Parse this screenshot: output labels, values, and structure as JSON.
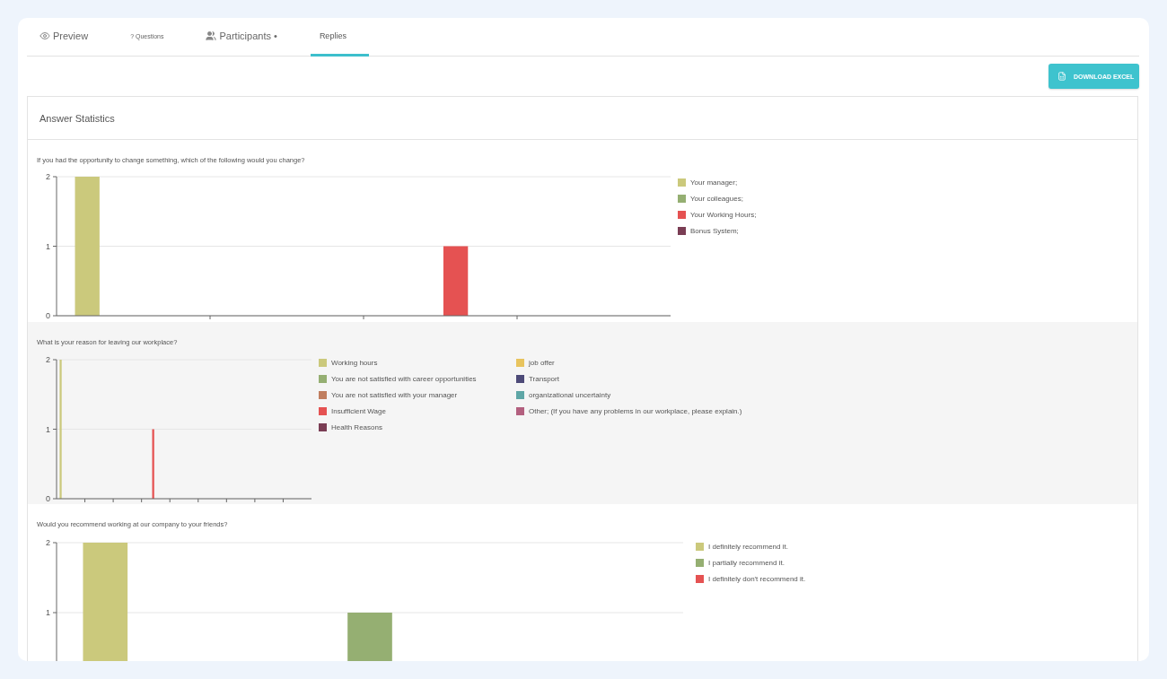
{
  "tabs": [
    {
      "label": "Preview",
      "selected": false
    },
    {
      "label": "? Questions",
      "selected": false
    },
    {
      "label": "Participants •",
      "selected": false
    },
    {
      "label": "Replies",
      "selected": true
    }
  ],
  "download_button": {
    "label": "DOWNLOAD EXCEL"
  },
  "panel": {
    "title": "Answer Statistics",
    "questions": [
      {
        "text": "If you had the opportunity to change something, which of the following would you change?",
        "chart_data": {
          "type": "bar",
          "ylim": [
            0,
            2
          ],
          "yticks": [
            0,
            1,
            2
          ],
          "series": [
            {
              "name": "Your manager;",
              "color": "#cbc97c",
              "values": [
                2,
                0,
                0,
                0
              ]
            },
            {
              "name": "Your colleagues;",
              "color": "#95af72",
              "values": [
                0,
                0,
                0,
                0
              ]
            },
            {
              "name": "Your Working Hours;",
              "color": "#e55252",
              "values": [
                0,
                0,
                1,
                0
              ]
            },
            {
              "name": "Bonus System;",
              "color": "#7a3d54",
              "values": [
                0,
                0,
                0,
                0
              ]
            }
          ]
        }
      },
      {
        "text": "What is your reason for leaving our workplace?",
        "chart_data": {
          "type": "bar",
          "ylim": [
            0,
            2
          ],
          "yticks": [
            0,
            1,
            2
          ],
          "series": [
            {
              "name": "Working hours",
              "color": "#cbc97c",
              "values": [
                2,
                0,
                0,
                0,
                0,
                0,
                0,
                0,
                0
              ]
            },
            {
              "name": "You are not satisfied with career opportunities",
              "color": "#95af72",
              "values": [
                0,
                0,
                0,
                0,
                0,
                0,
                0,
                0,
                0
              ]
            },
            {
              "name": "You are not satisfied with your manager",
              "color": "#c07e5f",
              "values": [
                0,
                0,
                0,
                0,
                0,
                0,
                0,
                0,
                0
              ]
            },
            {
              "name": "Insufficient Wage",
              "color": "#e55252",
              "values": [
                0,
                0,
                0,
                1,
                0,
                0,
                0,
                0,
                0
              ]
            },
            {
              "name": "Health Reasons",
              "color": "#7a3d54",
              "values": [
                0,
                0,
                0,
                0,
                0,
                0,
                0,
                0,
                0
              ]
            },
            {
              "name": "job offer",
              "color": "#e8c45e",
              "values": [
                0,
                0,
                0,
                0,
                0,
                0,
                0,
                0,
                0
              ]
            },
            {
              "name": "Transport",
              "color": "#4d4a78",
              "values": [
                0,
                0,
                0,
                0,
                0,
                0,
                0,
                0,
                0
              ]
            },
            {
              "name": "organizational uncertainty",
              "color": "#5ea6a6",
              "values": [
                0,
                0,
                0,
                0,
                0,
                0,
                0,
                0,
                0
              ]
            },
            {
              "name": "Other; (If you have any problems in our workplace, please explain.)",
              "color": "#b3607f",
              "values": [
                0,
                0,
                0,
                0,
                0,
                0,
                0,
                0,
                0
              ]
            }
          ]
        }
      },
      {
        "text": "Would you recommend working at our company to your friends?",
        "chart_data": {
          "type": "bar",
          "ylim": [
            0,
            2
          ],
          "yticks": [
            1,
            2
          ],
          "series": [
            {
              "name": "I definitely recommend it.",
              "color": "#cbc97c",
              "values": [
                2,
                0,
                0
              ]
            },
            {
              "name": "I partially recommend it.",
              "color": "#95af72",
              "values": [
                0,
                1,
                0
              ]
            },
            {
              "name": "I definitely don't recommend it.",
              "color": "#e55252",
              "values": [
                0,
                0,
                0
              ]
            }
          ]
        }
      }
    ]
  }
}
